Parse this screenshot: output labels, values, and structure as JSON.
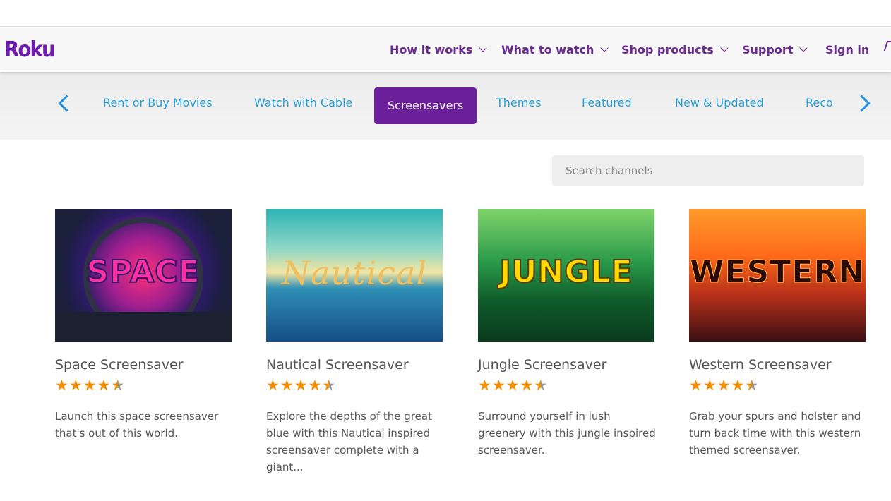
{
  "brand": {
    "logo": "Roku"
  },
  "nav": {
    "how_it_works": "How it works",
    "what_to_watch": "What to watch",
    "shop_products": "Shop products",
    "support": "Support",
    "sign_in": "Sign in"
  },
  "categories": {
    "items": [
      "Rent or Buy Movies",
      "Watch with Cable",
      "Screensavers",
      "Themes",
      "Featured",
      "New & Updated",
      "Reco"
    ],
    "active": "Screensavers"
  },
  "search": {
    "placeholder": "Search channels",
    "value": ""
  },
  "cards": [
    {
      "thumb_text": "SPACE",
      "title": "Space Screensaver",
      "rating": 4.5,
      "description": "Launch this space screensaver that's out of this world."
    },
    {
      "thumb_text": "Nautical",
      "title": "Nautical Screensaver",
      "rating": 4.5,
      "description": "Explore the depths of the great blue with this Nautical inspired screensaver complete with a giant..."
    },
    {
      "thumb_text": "JUNGLE",
      "title": "Jungle Screensaver",
      "rating": 4.5,
      "description": "Surround yourself in lush greenery with this jungle inspired screensaver."
    },
    {
      "thumb_text": "WESTERN",
      "title": "Western Screensaver",
      "rating": 4.5,
      "description": "Grab your spurs and holster and turn back time with this western themed screensaver."
    }
  ],
  "colors": {
    "brand_purple": "#6f1ab1",
    "active_tab": "#6c1f9a",
    "link_blue": "#27a0d8",
    "arrow_blue": "#1f8fe0",
    "star": "#f28c00"
  },
  "icons": {
    "left_arrow": "chevron-left-icon",
    "right_arrow": "chevron-right-icon",
    "nav_caret": "chevron-down-icon",
    "cart": "cart-icon",
    "star": "star-icon"
  }
}
